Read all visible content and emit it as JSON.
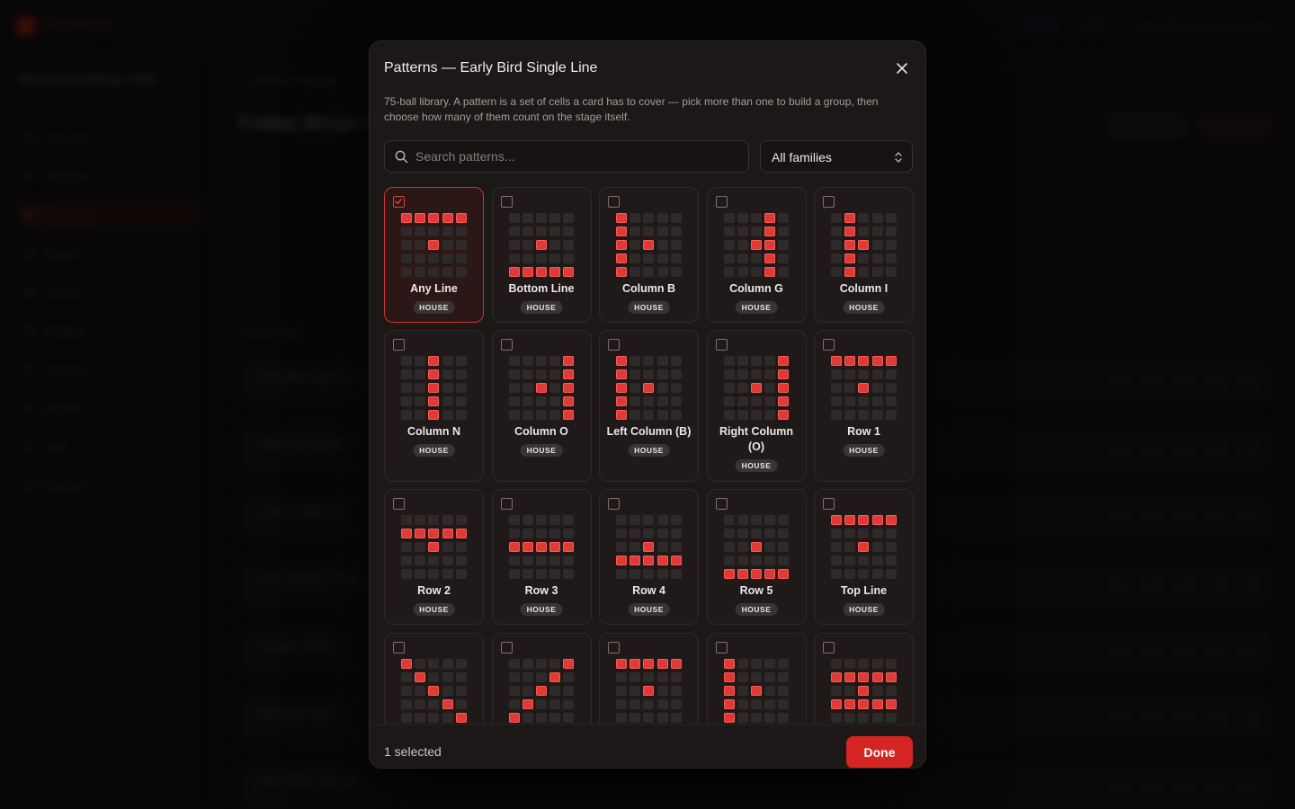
{
  "background_app": {
    "brand": "FlairBingo",
    "org_name": "Riverbend Bingo Hall",
    "user": "admin@riverbend.example",
    "breadcrumb": "Back to Program",
    "page_title": "Friday Bingo Night",
    "section_label": "Session list",
    "footer": "riverbend bingo · version",
    "nav": [
      "Overview",
      "Sessions",
      "Programs",
      "Players",
      "Cashier",
      "Displays",
      "Jackpots",
      "Reports",
      "Staff",
      "Settings"
    ],
    "rows": [
      "Early Bird Single Line",
      "Warm-Up Double",
      "Letter X Special",
      "Four Corners Classic",
      "Postage Stamp",
      "Blackout Finale",
      "Late Night Coverall"
    ]
  },
  "modal": {
    "title": "Patterns — Early Bird Single Line",
    "description": "75-ball library. A pattern is a set of cells a card has to cover — pick more than one to build a group, then choose how many of them count on the stage itself.",
    "search_placeholder": "Search patterns...",
    "family_filter": "All families",
    "selected_count": "1 selected",
    "done_label": "Done",
    "accent_color": "#d42522"
  },
  "patterns": [
    {
      "name": "Any Line",
      "family": "HOUSE",
      "selected": true,
      "cells": [
        0,
        1,
        2,
        3,
        4,
        12
      ]
    },
    {
      "name": "Bottom Line",
      "family": "HOUSE",
      "selected": false,
      "cells": [
        12,
        20,
        21,
        22,
        23,
        24
      ]
    },
    {
      "name": "Column B",
      "family": "HOUSE",
      "selected": false,
      "cells": [
        0,
        5,
        10,
        12,
        15,
        20
      ]
    },
    {
      "name": "Column G",
      "family": "HOUSE",
      "selected": false,
      "cells": [
        3,
        8,
        12,
        13,
        18,
        23
      ]
    },
    {
      "name": "Column I",
      "family": "HOUSE",
      "selected": false,
      "cells": [
        1,
        6,
        11,
        12,
        16,
        21
      ]
    },
    {
      "name": "Column N",
      "family": "HOUSE",
      "selected": false,
      "cells": [
        2,
        7,
        12,
        17,
        22
      ]
    },
    {
      "name": "Column O",
      "family": "HOUSE",
      "selected": false,
      "cells": [
        4,
        9,
        12,
        14,
        19,
        24
      ]
    },
    {
      "name": "Left Column (B)",
      "family": "HOUSE",
      "selected": false,
      "cells": [
        0,
        5,
        10,
        12,
        15,
        20
      ]
    },
    {
      "name": "Right Column (O)",
      "family": "HOUSE",
      "selected": false,
      "cells": [
        4,
        9,
        12,
        14,
        19,
        24
      ]
    },
    {
      "name": "Row 1",
      "family": "HOUSE",
      "selected": false,
      "cells": [
        0,
        1,
        2,
        3,
        4,
        12
      ]
    },
    {
      "name": "Row 2",
      "family": "HOUSE",
      "selected": false,
      "cells": [
        5,
        6,
        7,
        8,
        9,
        12
      ]
    },
    {
      "name": "Row 3",
      "family": "HOUSE",
      "selected": false,
      "cells": [
        10,
        11,
        12,
        13,
        14
      ]
    },
    {
      "name": "Row 4",
      "family": "HOUSE",
      "selected": false,
      "cells": [
        12,
        15,
        16,
        17,
        18,
        19
      ]
    },
    {
      "name": "Row 5",
      "family": "HOUSE",
      "selected": false,
      "cells": [
        12,
        20,
        21,
        22,
        23,
        24
      ]
    },
    {
      "name": "Top Line",
      "family": "HOUSE",
      "selected": false,
      "cells": [
        0,
        1,
        2,
        3,
        4,
        12
      ]
    },
    {
      "name": "",
      "family": "",
      "selected": false,
      "cells": [
        0,
        6,
        12,
        18,
        24
      ]
    },
    {
      "name": "",
      "family": "",
      "selected": false,
      "cells": [
        4,
        8,
        12,
        16,
        20
      ]
    },
    {
      "name": "",
      "family": "",
      "selected": false,
      "cells": [
        0,
        1,
        2,
        3,
        4,
        12
      ]
    },
    {
      "name": "",
      "family": "",
      "selected": false,
      "cells": [
        0,
        5,
        10,
        12,
        15,
        20
      ]
    },
    {
      "name": "",
      "family": "",
      "selected": false,
      "cells": [
        5,
        6,
        7,
        8,
        9,
        12,
        15,
        16,
        17,
        18,
        19
      ]
    }
  ]
}
